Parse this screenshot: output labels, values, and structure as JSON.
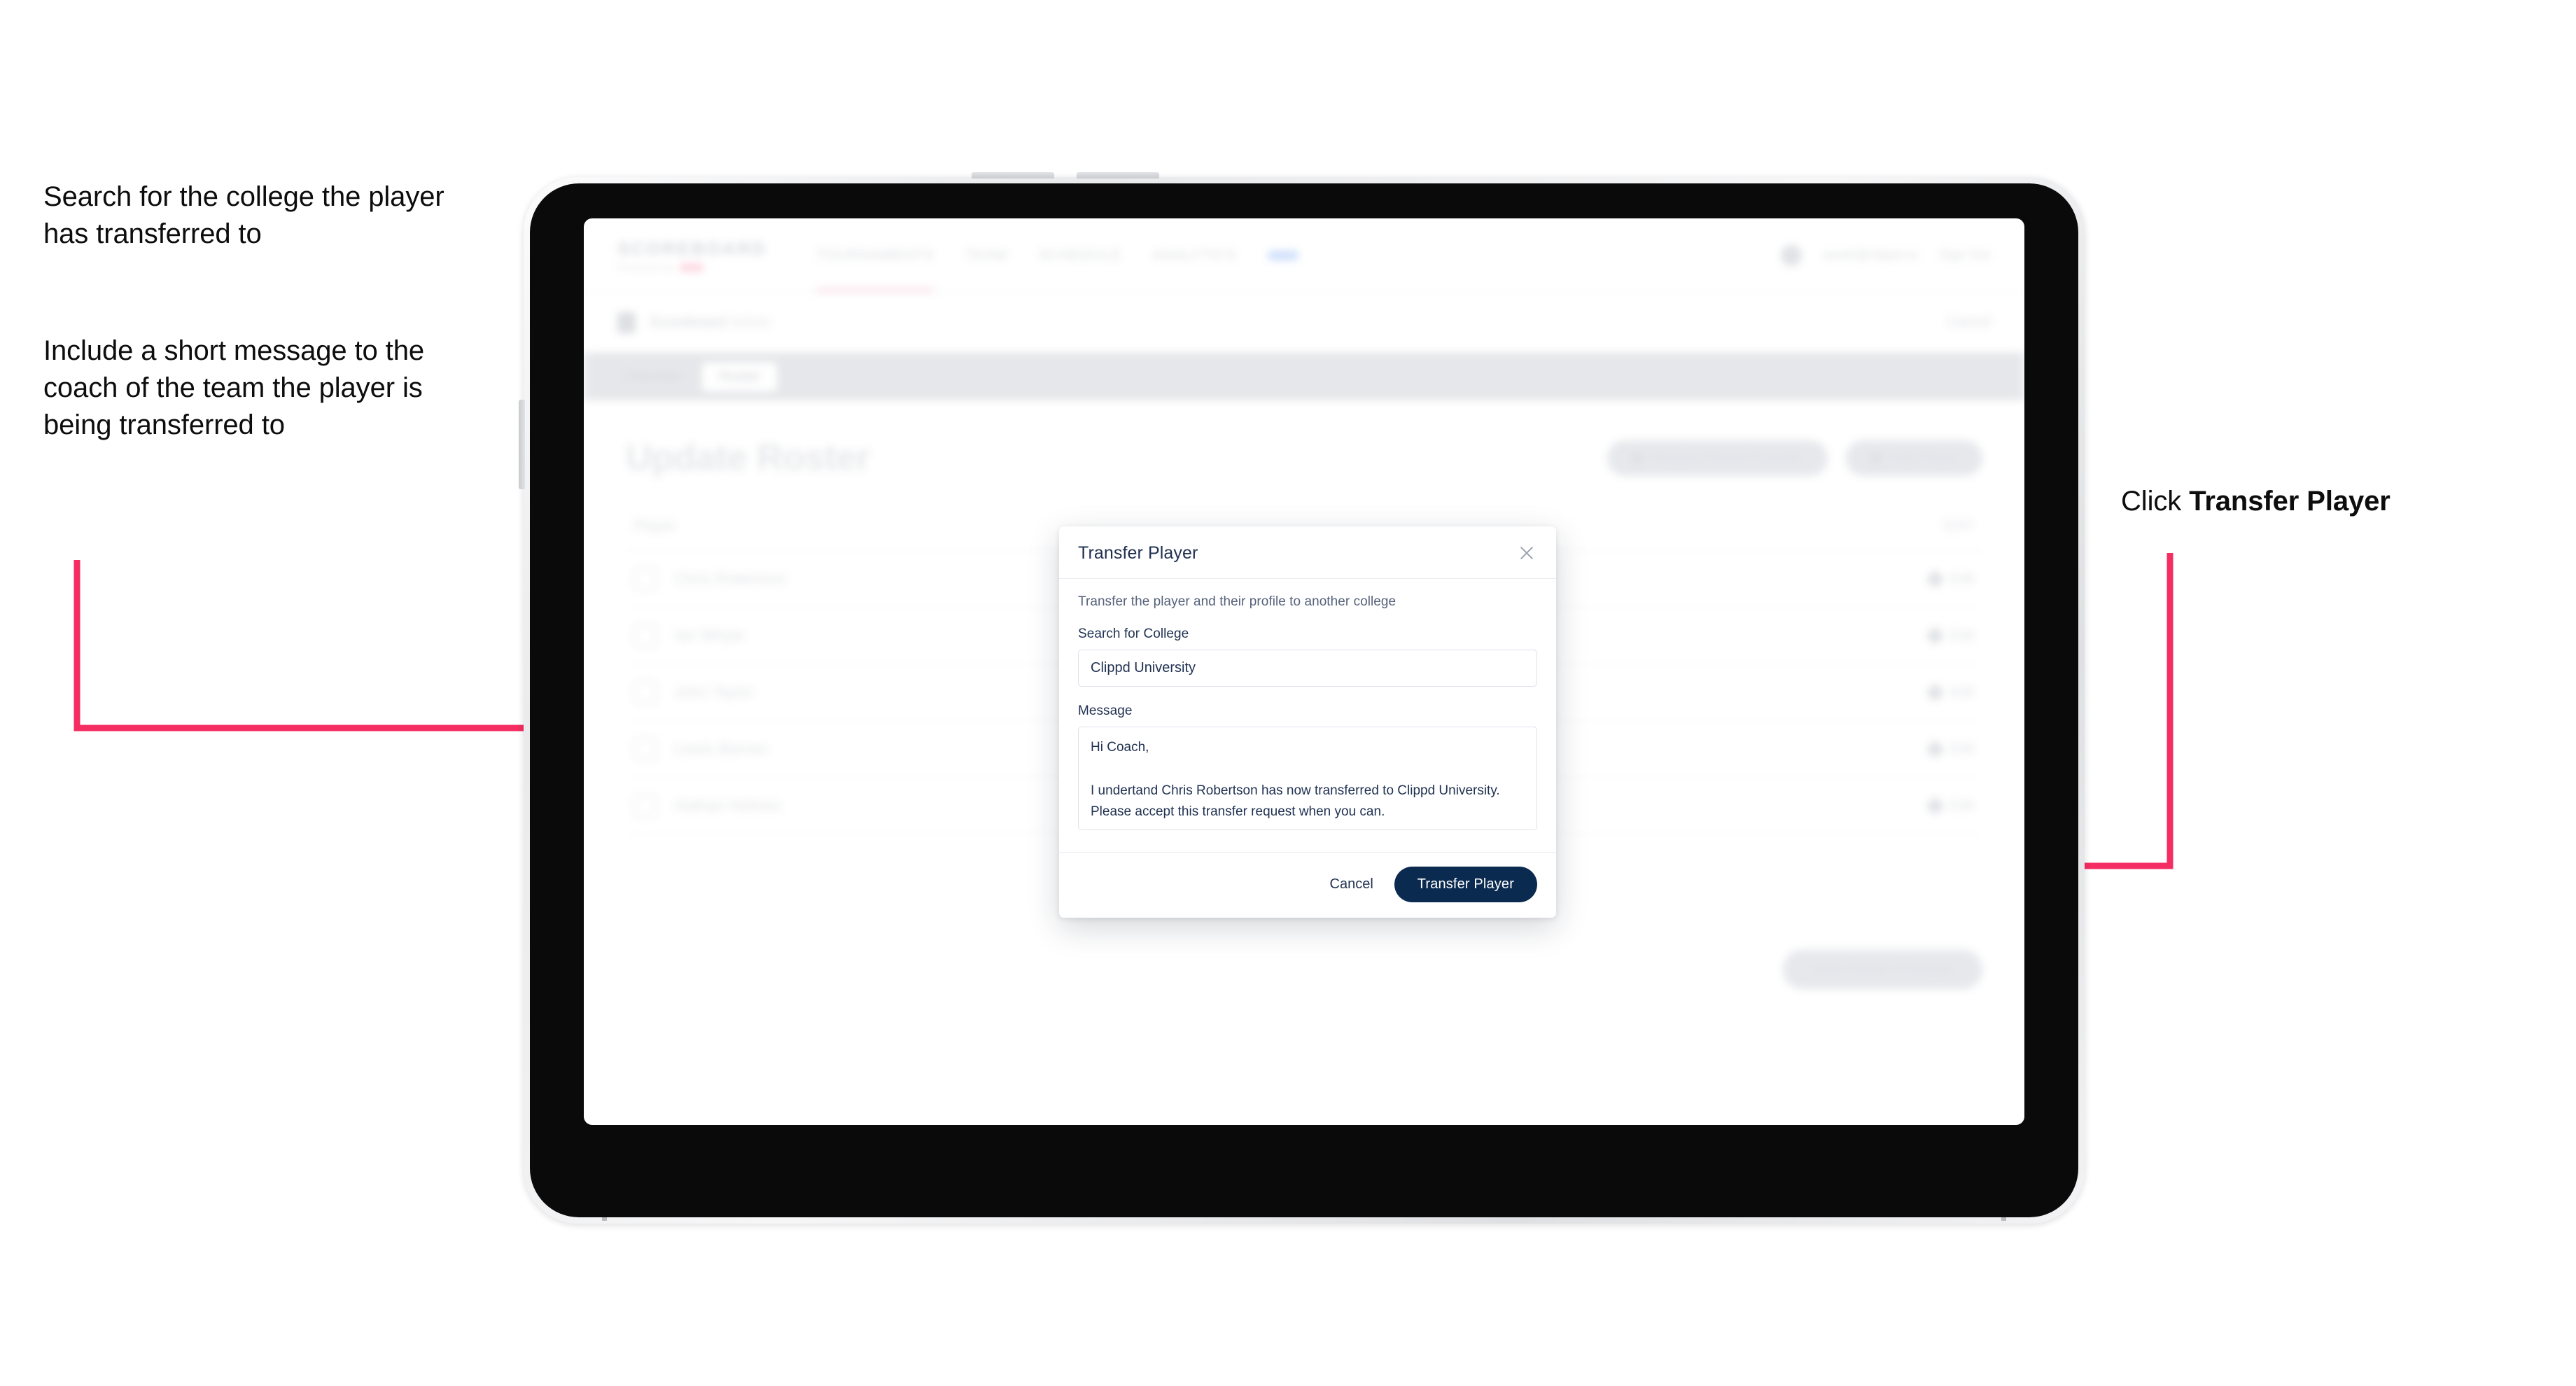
{
  "annotations": {
    "left_note_1": "Search for the college the player has transferred to",
    "left_note_2": "Include a short message to the coach of the team the player is being transferred to",
    "right_note_prefix": "Click ",
    "right_note_bold": "Transfer Player"
  },
  "colors": {
    "arrow_pink": "#F42D62",
    "primary_navy": "#0B2A50",
    "modal_text": "#1F3050",
    "brand_pink": "#FBB9CA"
  },
  "app": {
    "brand": {
      "name": "SCOREBOARD",
      "tagline": "Powered by",
      "tagline_mark": ""
    },
    "topnav": [
      {
        "label": "TOURNAMENTS"
      },
      {
        "label": "TEAM"
      },
      {
        "label": "SCHEDULE"
      },
      {
        "label": "ANALYTICS"
      },
      {
        "label": ""
      }
    ],
    "topnav_active_index": 0,
    "topbar_right": {
      "account": "sarah@clippd.io",
      "sign_out": "Sign Out"
    },
    "breadcrumb": {
      "title": "Scoreboard",
      "muted": "Admin",
      "right_action": "Cancel"
    },
    "tabs": [
      {
        "label": "Overview",
        "active": false
      },
      {
        "label": "Roster",
        "active": true
      }
    ],
    "page": {
      "title": "Update Roster",
      "actions": [
        {
          "label": "Request Roster Transfer",
          "icon": "transfer-icon"
        },
        {
          "label": "Add Player",
          "icon": "plus-icon"
        }
      ],
      "table": {
        "header_left": "Player",
        "header_right": "EDIT",
        "rows": [
          {
            "name": "Chris Robertson",
            "action": "Edit"
          },
          {
            "name": "Ian Whyte",
            "action": "Edit"
          },
          {
            "name": "John Taylor",
            "action": "Edit"
          },
          {
            "name": "Lewis Barnes",
            "action": "Edit"
          },
          {
            "name": "Nathan Holmes",
            "action": "Edit"
          }
        ]
      },
      "bottom_cta": "Save Roster Changes"
    }
  },
  "modal": {
    "title": "Transfer Player",
    "close_icon": "close-icon",
    "description": "Transfer the player and their profile to another college",
    "college_field": {
      "label": "Search for College",
      "value": "Clippd University",
      "placeholder": "Search for College"
    },
    "message_field": {
      "label": "Message",
      "value": "Hi Coach,\n\nI undertand Chris Robertson has now transferred to Clippd University.\nPlease accept this transfer request when you can.",
      "placeholder": "Message"
    },
    "cancel_label": "Cancel",
    "submit_label": "Transfer Player"
  }
}
